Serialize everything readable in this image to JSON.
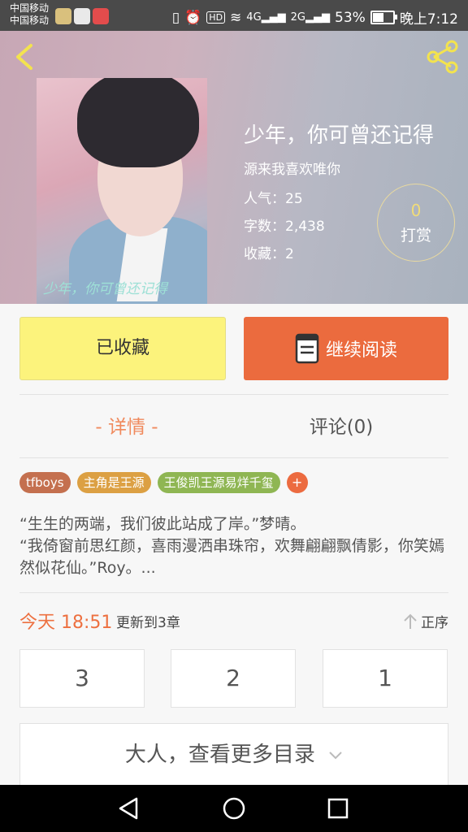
{
  "status_bar": {
    "carrier_1": "中国移动",
    "carrier_2": "中国移动",
    "signal_1": "4G",
    "signal_2": "2G",
    "battery": "53%",
    "time": "晚上7:12"
  },
  "book": {
    "title": "少年，你可曾还记得",
    "author": "源来我喜欢唯你",
    "popularity_label": "人气：",
    "popularity": "25",
    "words_label": "字数：",
    "words": "2,438",
    "favorites_label": "收藏：",
    "favorites": "2",
    "cover_text": "少年，你可曾还记得"
  },
  "reward": {
    "count": "0",
    "label": "打赏"
  },
  "buttons": {
    "collected": "已收藏",
    "continue_read": "继续阅读"
  },
  "tabs": {
    "detail": "- 详情 -",
    "comments": "评论(0)"
  },
  "tags": [
    {
      "label": "tfboys",
      "color": "#c4704f"
    },
    {
      "label": "主角是王源",
      "color": "#dca043"
    },
    {
      "label": "王俊凯王源易烊千玺",
      "color": "#8fb653"
    }
  ],
  "tag_add": "+",
  "description": [
    "“生生的两端，我们彼此站成了岸。”梦晴。",
    "“我倚窗前思红颜，喜雨漫洒串珠帘，欢舞翩翩飘倩影，你笑嫣然似花仙。”Roy。..."
  ],
  "update": {
    "time": "今天 18:51",
    "text": "更新到3章"
  },
  "order_label": "正序",
  "chapters": [
    "3",
    "2",
    "1"
  ],
  "more_catalog": "大人，查看更多目录",
  "colors": {
    "accent": "#eb6b3e",
    "collected_bg": "#fcf37c"
  }
}
